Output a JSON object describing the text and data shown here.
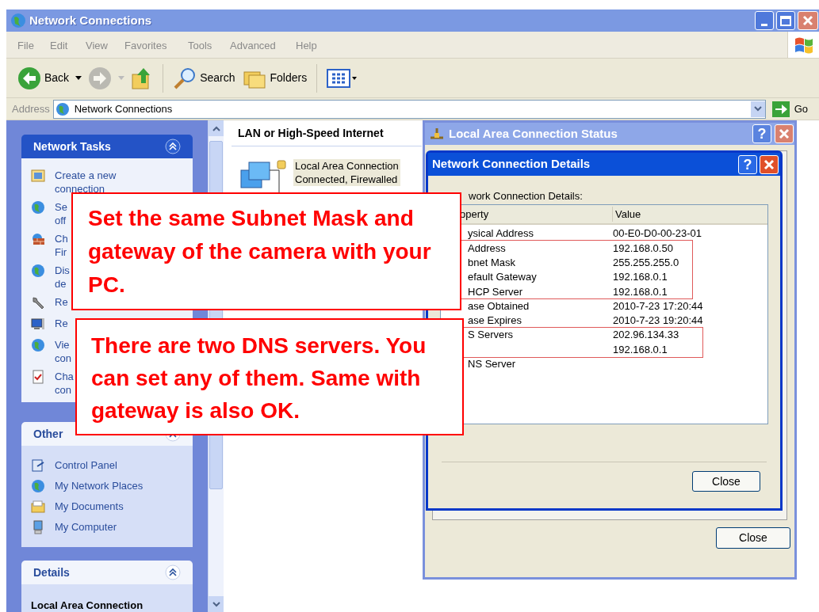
{
  "window": {
    "title": "Network Connections"
  },
  "menu": [
    "File",
    "Edit",
    "View",
    "Favorites",
    "Tools",
    "Advanced",
    "Help"
  ],
  "toolbar": [
    {
      "kind": "back",
      "label": "Back",
      "disabled": false
    },
    {
      "kind": "forward",
      "disabled": true
    },
    {
      "kind": "up",
      "disabled": false
    },
    {
      "kind": "search",
      "label": "Search",
      "disabled": false
    },
    {
      "kind": "folders",
      "label": "Folders",
      "disabled": false
    },
    {
      "kind": "views",
      "disabled": false
    }
  ],
  "address": {
    "label": "Address",
    "value": "Network Connections",
    "go": "Go"
  },
  "sidebar": {
    "panels": [
      {
        "title": "Network Tasks",
        "kind": "special",
        "items": [
          {
            "kind": "link",
            "lines": [
              "Create a new",
              "connection"
            ]
          },
          {
            "kind": "link",
            "lines": [
              "Se",
              "off"
            ]
          },
          {
            "kind": "link",
            "lines": [
              "Ch",
              "Fir"
            ]
          },
          {
            "kind": "link",
            "lines": [
              "Dis",
              "de"
            ]
          },
          {
            "kind": "link",
            "lines": [
              "Re"
            ]
          },
          {
            "kind": "link",
            "lines": [
              "Re"
            ]
          },
          {
            "kind": "link",
            "lines": [
              "Vie",
              "con"
            ]
          },
          {
            "kind": "link",
            "lines": [
              "Cha",
              "con"
            ]
          }
        ]
      },
      {
        "title": "Other",
        "kind": "normal",
        "items": [
          {
            "kind": "link",
            "lines": [
              "Control Panel"
            ]
          },
          {
            "kind": "link",
            "lines": [
              "My Network Places"
            ]
          },
          {
            "kind": "link",
            "lines": [
              "My Documents"
            ]
          },
          {
            "kind": "link",
            "lines": [
              "My Computer"
            ]
          }
        ]
      },
      {
        "title": "Details",
        "kind": "normal",
        "items": [
          {
            "kind": "heading",
            "lines": [
              "Local Area Connection"
            ]
          }
        ]
      }
    ]
  },
  "content": {
    "group": "LAN or High-Speed Internet",
    "connection": {
      "selected": true,
      "lines": [
        "Local Area Connection",
        "Connected, Firewalled"
      ]
    }
  },
  "status_dialog": {
    "title": "Local Area Connection Status",
    "help_button": "?",
    "close": "Close"
  },
  "details_dialog": {
    "title": "Network Connection Details",
    "help_button": "?",
    "label": "work Connection Details:",
    "columns": [
      "operty",
      "Value"
    ],
    "rows": [
      {
        "property": "ysical Address",
        "value": "00-E0-D0-00-23-01",
        "highlighted": false
      },
      {
        "property": "Address",
        "value": "192.168.0.50",
        "highlighted": true
      },
      {
        "property": "bnet Mask",
        "value": "255.255.255.0",
        "highlighted": true
      },
      {
        "property": "efault Gateway",
        "value": "192.168.0.1",
        "highlighted": true
      },
      {
        "property": "HCP Server",
        "value": "192.168.0.1",
        "highlighted": true
      },
      {
        "property": "ase Obtained",
        "value": "2010-7-23 17:20:44",
        "highlighted": false
      },
      {
        "property": "ase Expires",
        "value": "2010-7-23 19:20:44",
        "highlighted": false
      },
      {
        "property": "S Servers",
        "value": "202.96.134.33",
        "highlighted": true
      },
      {
        "value": "192.168.0.1",
        "highlighted": true
      },
      {
        "property": "NS Server",
        "highlighted": false
      }
    ],
    "close": "Close"
  },
  "callouts": [
    {
      "text": "Set the same Subnet Mask and gateway of the camera with your PC."
    },
    {
      "text": "There are two DNS servers. You can set any of them. Same with gateway is also OK."
    }
  ]
}
